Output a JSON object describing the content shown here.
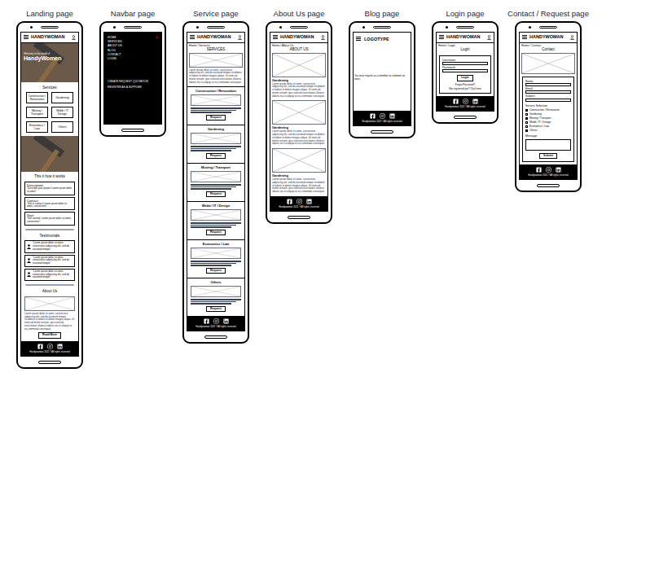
{
  "brand": "HANDYWOMAN",
  "footer": "Handywoman 2021 ©All rights reserved",
  "landing": {
    "title": "Landing page",
    "hero_small": "Welcome to the world of",
    "hero_big": "HandyWomen",
    "services_heading": "Services",
    "services": [
      "Construction / Renovation",
      "Gardening",
      "Moving / Transport",
      "Webb / IT Design",
      "Economics / Law",
      "Others"
    ],
    "how_heading": "This it how it works",
    "steps": [
      {
        "label": "Description",
        "text": "\"Describe your project Lorem ipsum dolor sit amet\""
      },
      {
        "label": "Contact",
        "text": "\"Get in contact Lorem ipsum dolor sit amet, consectetur\""
      },
      {
        "label": "Start",
        "text": "\"Get started. Lorem ipsum dolor sit amet, consectetur\""
      }
    ],
    "testimonials_heading": "Testimonials",
    "testimonials": [
      "\"Lorem ipsum dolor sit amet, consectetur adipiscing elit, sed do eiusmod tempor\"",
      "\"Lorem ipsum dolor sit amet, consectetur adipiscing elit, sed do eiusmod tempor\"",
      "\"Lorem ipsum dolor sit amet, consectetur adipiscing elit, sed do eiusmod tempor\""
    ],
    "about_heading": "About Us",
    "about_text": "Lorem ipsum dolor sit amet, consectetur adipiscing elit, sed do eiusmod tempor incididunt ut labore et dolore magna aliqua. Ut enim ad minim veniam, quis nostrud exercitation ullamco laboris nisi ut aliquip ex ea commodo consequat.",
    "read_more": "Read More"
  },
  "navbar": {
    "title": "Navbar page",
    "close": "X",
    "items": [
      "HOME",
      "SERVICES",
      "ABOUT US",
      "BLOG",
      "CONTACT",
      "LOGIN"
    ],
    "actions": [
      "CREATE REQUEST QUOTATION",
      "REGISTER AS A SUPPLIER"
    ]
  },
  "services_page": {
    "title": "Service page",
    "breadcrumb": "Home / Services",
    "heading": "SERVICES",
    "intro": "Lorem ipsum dolor sit amet, consectetur adipiscing elit, sed do eiusmod tempor incididunt ut labore et dolore magna aliqua. Ut enim ad minim veniam, quis nostrud exercitation ullamco laboris nisi ut aliquip ex ea commodo consequat.",
    "cards": [
      "Construction / Renovation",
      "Gardening",
      "Moving / Transport",
      "Webb / IT / Design",
      "Economics / Law",
      "Others"
    ],
    "button": "Request"
  },
  "about": {
    "title": "About Us page",
    "breadcrumb": "Home / About Us",
    "heading": "ABOUT US",
    "sections": [
      {
        "name": "Gardening",
        "text": "Lorem ipsum dolor sit amet, consectetur adipiscing elit, sed do eiusmod tempor incididunt ut labore et dolore magna aliqua. Ut enim ad minim veniam, quis nostrud exercitation ullamco laboris nisi ut aliquip ex ea commodo consequat."
      },
      {
        "name": "Gardening",
        "text": "Lorem ipsum dolor sit amet, consectetur adipiscing elit, sed do eiusmod tempor incididunt ut labore et dolore magna aliqua. Ut enim ad minim veniam, quis nostrud exercitation ullamco laboris nisi ut aliquip ex ea commodo consequat."
      },
      {
        "name": "Gardening",
        "text": "Lorem ipsum dolor sit amet, consectetur adipiscing elit, sed do eiusmod tempor incididunt ut labore et dolore magna aliqua. Ut enim ad minim veniam, quis nostrud exercitation ullamco laboris nisi ut aliquip ex ea commodo consequat."
      }
    ]
  },
  "blog": {
    "title": "Blog page",
    "logo": "LOGOTYPE",
    "notice": "You must register as a member to comment on posts"
  },
  "login": {
    "title": "Login page",
    "breadcrumb": "Home / Login",
    "heading": "Login",
    "fields": [
      "Username",
      "Password"
    ],
    "button": "Login",
    "forgot": "Forgot Password?",
    "register": "Not registered yet? Click here"
  },
  "contact": {
    "title": "Contact / Request page",
    "breadcrumb": "Home / Contact",
    "heading": "Contact",
    "fields": [
      "Name",
      "Email",
      "Subject"
    ],
    "selection_label": "Service Selection",
    "options": [
      {
        "label": "Construction / Renovation",
        "checked": true
      },
      {
        "label": "Gardening",
        "checked": false
      },
      {
        "label": "Moving / Transport",
        "checked": true
      },
      {
        "label": "Webb / IT / Design",
        "checked": false
      },
      {
        "label": "Economics / Law",
        "checked": false
      },
      {
        "label": "Others",
        "checked": true
      }
    ],
    "message_label": "Message",
    "button": "Submit"
  }
}
